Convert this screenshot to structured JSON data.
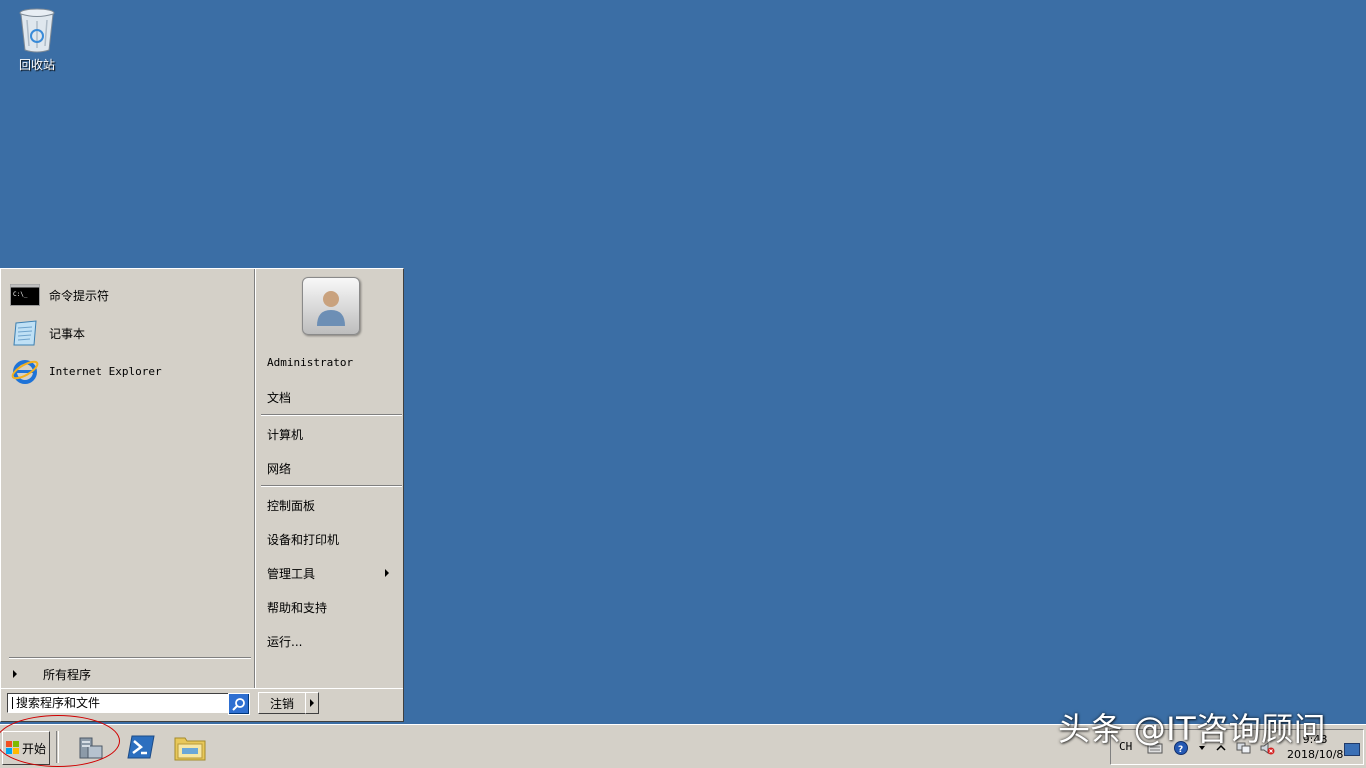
{
  "desktop": {
    "icons": [
      {
        "label": "回收站",
        "icon": "recycle-bin-icon"
      }
    ]
  },
  "start_menu": {
    "pinned_programs": [
      {
        "label": "命令提示符",
        "icon": "cmd-icon"
      },
      {
        "label": "记事本",
        "icon": "notepad-icon"
      },
      {
        "label": "Internet Explorer",
        "icon": "ie-icon"
      }
    ],
    "all_programs_label": "所有程序",
    "search_placeholder": "搜索程序和文件",
    "user_name": "Administrator",
    "right_items": {
      "documents": "文档",
      "computer": "计算机",
      "network": "网络",
      "control_panel": "控制面板",
      "devices_printers": "设备和打印机",
      "admin_tools": "管理工具",
      "help_support": "帮助和支持",
      "run": "运行..."
    },
    "logoff_label": "注销"
  },
  "taskbar": {
    "start_label": "开始",
    "pinned": [
      "server-manager-icon",
      "powershell-icon",
      "explorer-icon"
    ],
    "tray": {
      "language": "CH",
      "date": "2018/10/8",
      "time": "9:48"
    }
  },
  "watermark": "头条 @IT咨询顾问",
  "colors": {
    "desktop": "#3b6ea5",
    "classic_face": "#d4d0c8",
    "annotation": "#d00000"
  }
}
